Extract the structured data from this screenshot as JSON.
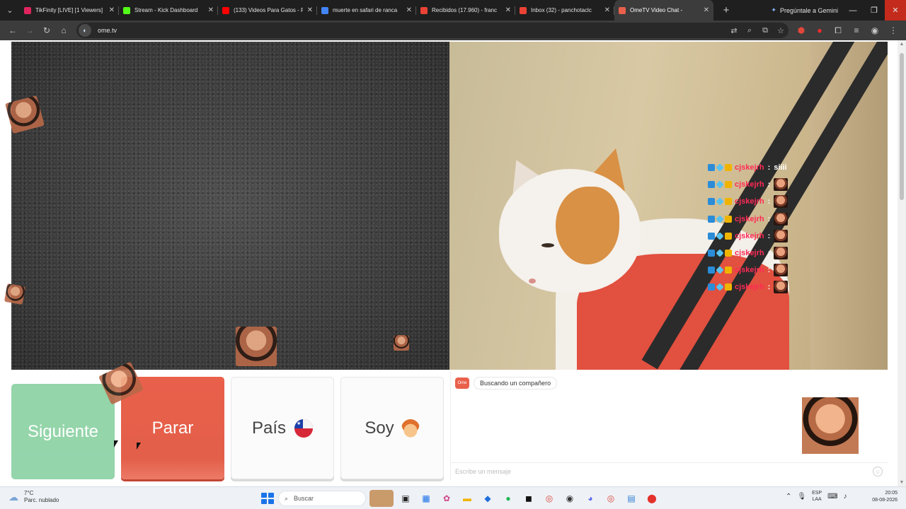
{
  "browser": {
    "tabs": [
      {
        "title": "TikFinity [LIVE] [1 Viewers]",
        "fav_color": "#e0245e",
        "active": false
      },
      {
        "title": "Stream - Kick Dashboard",
        "fav_color": "#53fc18",
        "active": false
      },
      {
        "title": "(133) Videos Para Gatos - F",
        "fav_color": "#ff0000",
        "active": false
      },
      {
        "title": "muerte en safari de ranca",
        "fav_color": "#4285f4",
        "active": false
      },
      {
        "title": "Recibidos (17.960) - franc",
        "fav_color": "#ea4335",
        "active": false
      },
      {
        "title": "Inbox (32) - panchotaclc",
        "fav_color": "#ea4335",
        "active": false
      },
      {
        "title": "OmeTV Video Chat -",
        "fav_color": "#e9604b",
        "active": true
      }
    ],
    "new_tab_symbol": "+",
    "gemini_label": "Pregúntale a Gemini",
    "url": "ome.tv"
  },
  "video": {
    "overlay_chat": [
      {
        "user": "cjskejrh",
        "message": "siiii",
        "has_emote": false
      },
      {
        "user": "cjskejrh",
        "message": "",
        "has_emote": true
      },
      {
        "user": "cjskejrh",
        "message": "",
        "has_emote": true
      },
      {
        "user": "cjskejrh",
        "message": "",
        "has_emote": true
      },
      {
        "user": "cjskejrh",
        "message": "",
        "has_emote": true
      },
      {
        "user": "cjskejrh",
        "message": "",
        "has_emote": true
      },
      {
        "user": "cjskejrh",
        "message": "",
        "has_emote": true
      },
      {
        "user": "cjskejrh",
        "message": "",
        "has_emote": true
      }
    ],
    "username_color": "#ff2a55"
  },
  "controls": {
    "next_label": "Siguiente",
    "stop_label": "Parar",
    "country_label": "País",
    "me_label": "Soy",
    "next_color": "#8fd3a6",
    "stop_color": "#e35f49"
  },
  "chat": {
    "status_text": "Buscando un compañero",
    "input_placeholder": "Escribe un mensaje"
  },
  "taskbar": {
    "temperature": "7°C",
    "weather_desc": "Parc. nublado",
    "search_label": "Buscar",
    "lang_line1": "ESP",
    "lang_line2": "LAA",
    "time": "20:05",
    "date": "08-08-2026"
  }
}
